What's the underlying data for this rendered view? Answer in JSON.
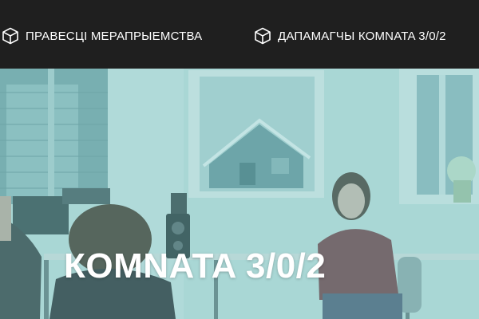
{
  "nav": {
    "items": [
      {
        "label": "ПРАВЕСЦІ МЕРАПРЫЕМСТВА",
        "icon": "cube-icon"
      },
      {
        "label": "ДАПАМАГЧЫ КОМNATA 3/0/2",
        "icon": "cube-icon"
      }
    ]
  },
  "hero": {
    "title": "КОМNATA 3/0/2"
  },
  "colors": {
    "topbar": "#1f1f1f",
    "nav_text": "#ffffff",
    "hero_tint": "#8fcaca"
  }
}
